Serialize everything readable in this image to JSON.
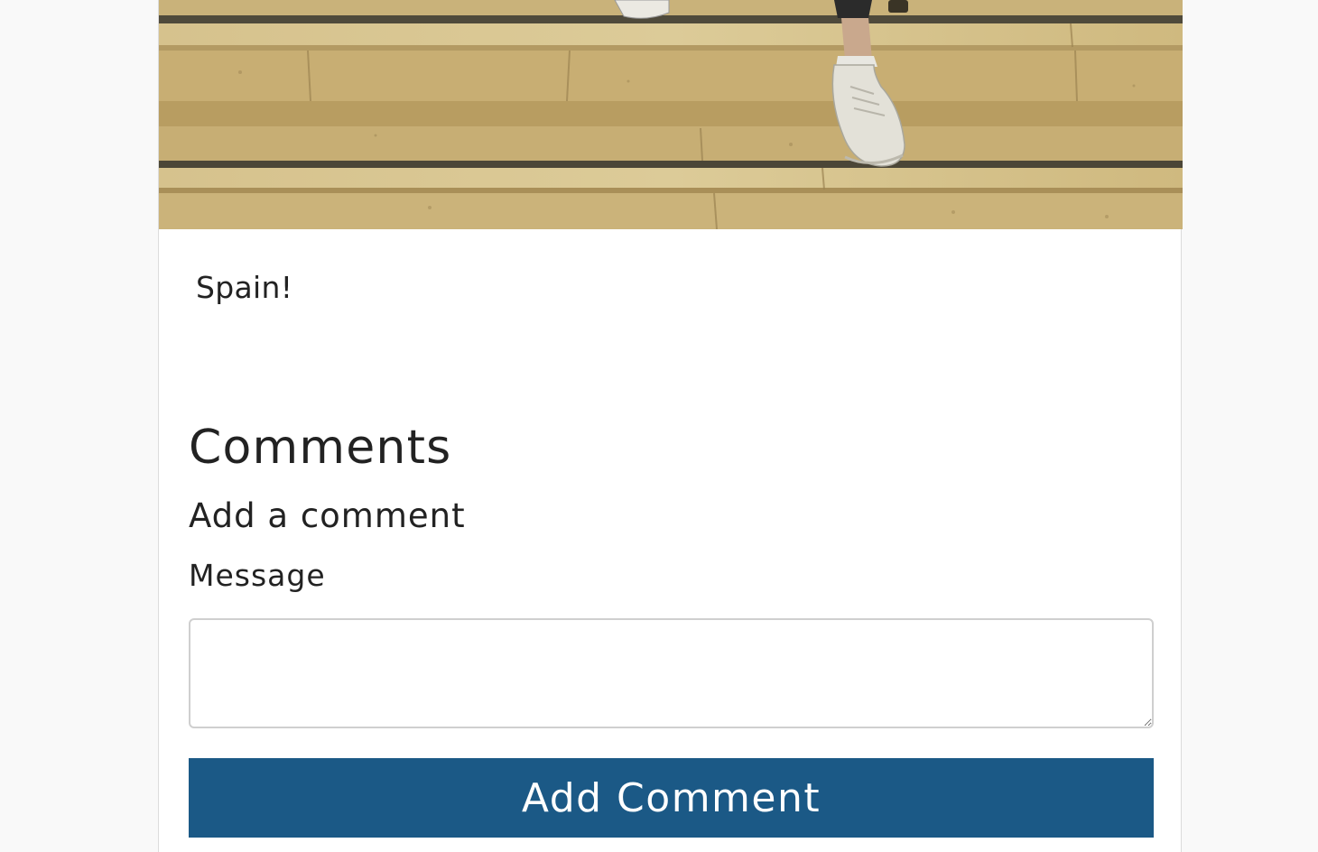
{
  "post": {
    "image_alt": "Stone steps with a person's legs in white sneakers",
    "text": "Spain!"
  },
  "comments": {
    "heading": "Comments",
    "form": {
      "heading": "Add a comment",
      "message_label": "Message",
      "message_value": "",
      "submit_label": "Add Comment"
    }
  },
  "colors": {
    "button_bg": "#1b5986",
    "button_text": "#ffffff",
    "page_bg": "#f9f9f9",
    "card_bg": "#ffffff"
  }
}
